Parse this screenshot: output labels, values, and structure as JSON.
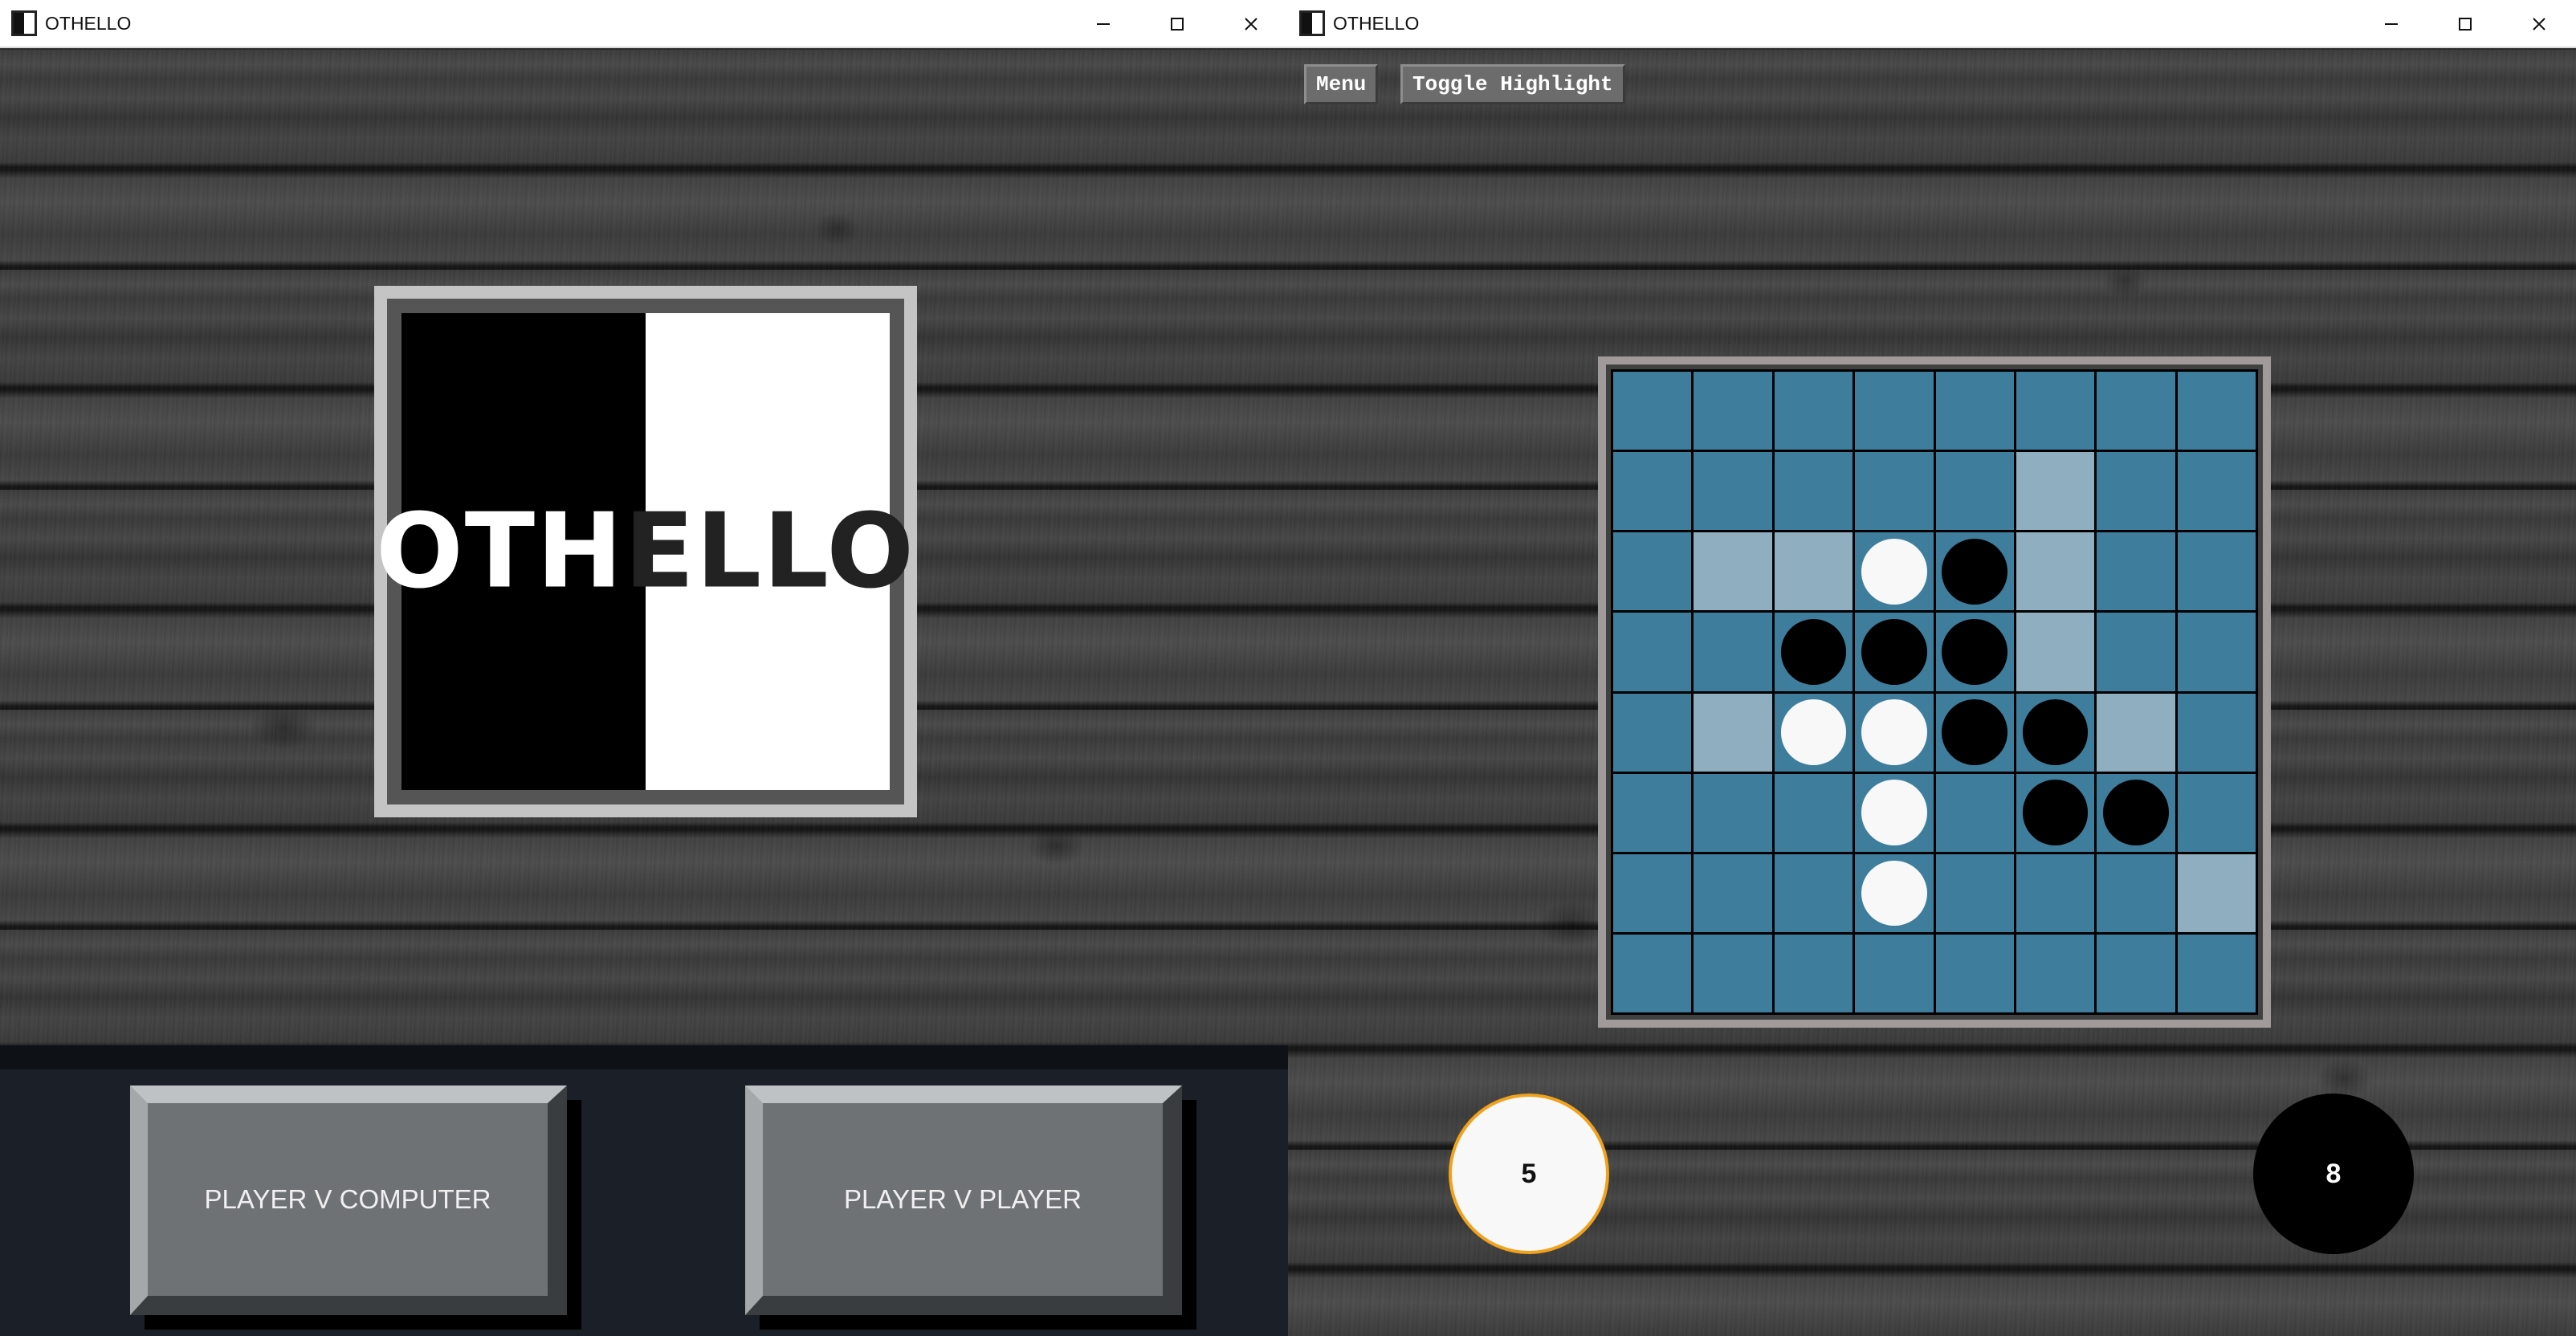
{
  "windows": [
    {
      "title": "OTHELLO"
    },
    {
      "title": "OTHELLO"
    }
  ],
  "window_controls": {
    "minimize_icon": "minimize-icon",
    "maximize_icon": "maximize-icon",
    "close_icon": "close-icon"
  },
  "menu_screen": {
    "logo": {
      "text_part_1": "OTH",
      "text_part_2": "ELLO"
    },
    "buttons": {
      "player_v_computer": "PLAYER V COMPUTER",
      "player_v_player": "PLAYER V PLAYER"
    }
  },
  "game_screen": {
    "toolbar": {
      "menu_label": "Menu",
      "toggle_highlight_label": "Toggle Highlight"
    },
    "board": {
      "size": 8,
      "rows": [
        [
          "",
          "",
          "",
          "",
          "",
          "",
          "",
          ""
        ],
        [
          "",
          "",
          "",
          "",
          "",
          "h",
          "",
          ""
        ],
        [
          "",
          "h",
          "h",
          "W",
          "B",
          "h",
          "",
          ""
        ],
        [
          "",
          "",
          "B",
          "B",
          "B",
          "h",
          "",
          ""
        ],
        [
          "",
          "h",
          "W",
          "W",
          "B",
          "B",
          "h",
          ""
        ],
        [
          "",
          "",
          "",
          "W",
          "",
          "B",
          "B",
          ""
        ],
        [
          "",
          "",
          "",
          "W",
          "",
          "",
          "",
          "h"
        ],
        [
          "",
          "",
          "",
          "",
          "",
          "",
          "",
          ""
        ]
      ],
      "legend": {
        "W": "white disc",
        "B": "black disc",
        "h": "highlighted valid move"
      }
    },
    "scores": {
      "white": "5",
      "black": "8"
    },
    "colors": {
      "board_cell": "#3f7d9c",
      "highlight_cell": "#8faec0",
      "active_player_ring": "#f0a21c"
    }
  }
}
